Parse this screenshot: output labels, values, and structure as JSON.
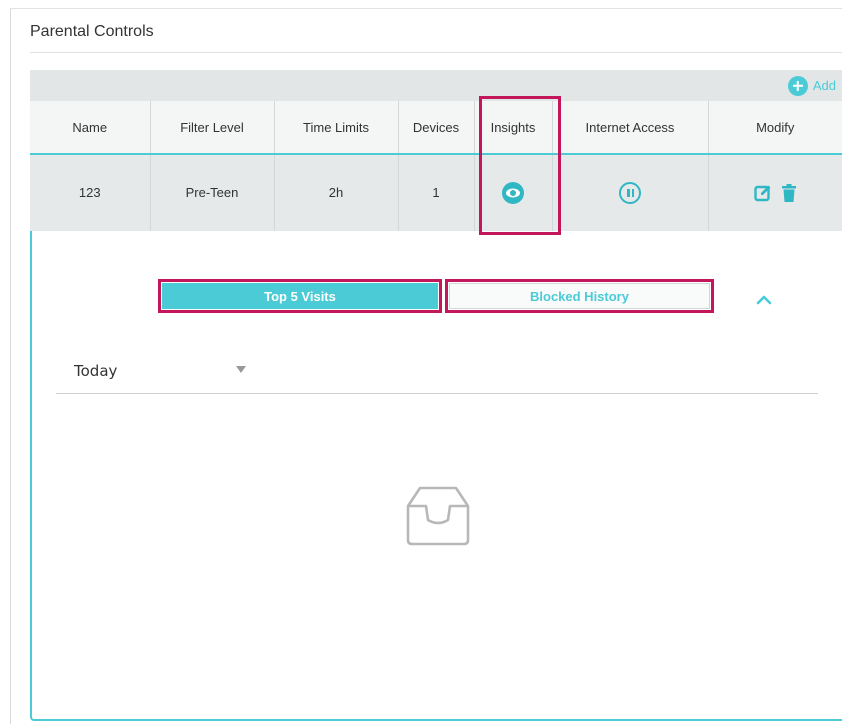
{
  "section": {
    "title": "Parental Controls"
  },
  "toolbar": {
    "add_label": "Add"
  },
  "table": {
    "columns": [
      "Name",
      "Filter Level",
      "Time Limits",
      "Devices",
      "Insights",
      "Internet Access",
      "Modify"
    ],
    "rows": [
      {
        "name": "123",
        "filter_level": "Pre-Teen",
        "time_limits": "2h",
        "devices": "1"
      }
    ]
  },
  "insights": {
    "tabs": [
      {
        "label": "Top 5 Visits",
        "active": true
      },
      {
        "label": "Blocked History",
        "active": false
      }
    ],
    "period": {
      "selected": "Today"
    }
  },
  "icons": {
    "add": "plus-circle-icon",
    "insights": "eye-icon",
    "internet_access": "pause-circle-icon",
    "edit": "edit-icon",
    "delete": "trash-icon",
    "collapse": "chevron-up-icon",
    "dropdown": "caret-down-icon",
    "empty": "empty-inbox-icon"
  },
  "colors": {
    "accent": "#4acbd6",
    "highlight": "#c2185b",
    "header_bg": "#f4f5f5",
    "row_bg": "#e6e9e9"
  }
}
